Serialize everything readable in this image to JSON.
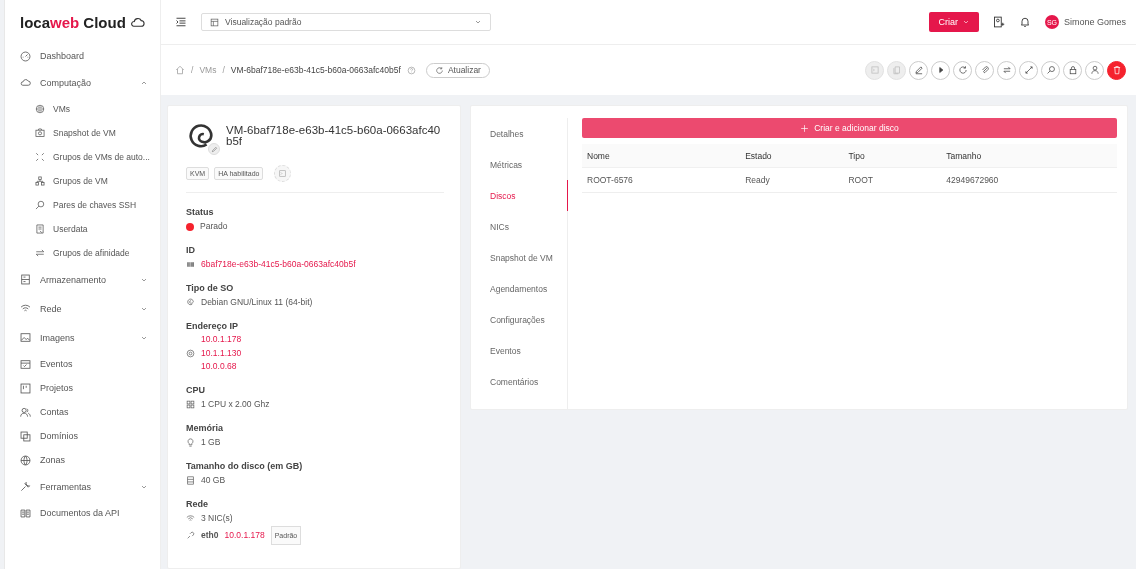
{
  "brand": {
    "prefix": "loca",
    "highlight": "web",
    "suffix": " Cloud"
  },
  "sidebar": {
    "items": [
      {
        "label": "Dashboard",
        "kind": "link"
      },
      {
        "label": "Computação",
        "kind": "group",
        "expanded": true,
        "children": [
          {
            "label": "VMs",
            "selected": false
          },
          {
            "label": "Snapshot de VM",
            "selected": false
          },
          {
            "label": "Grupos de VMs de auto...",
            "selected": false
          },
          {
            "label": "Grupos de VM",
            "selected": false
          },
          {
            "label": "Pares de chaves SSH",
            "selected": false
          },
          {
            "label": "Userdata",
            "selected": false
          },
          {
            "label": "Grupos de afinidade",
            "selected": false
          }
        ]
      },
      {
        "label": "Armazenamento",
        "kind": "group",
        "expanded": false
      },
      {
        "label": "Rede",
        "kind": "group",
        "expanded": false
      },
      {
        "label": "Imagens",
        "kind": "group",
        "expanded": false
      },
      {
        "label": "Eventos",
        "kind": "link"
      },
      {
        "label": "Projetos",
        "kind": "link"
      },
      {
        "label": "Contas",
        "kind": "link"
      },
      {
        "label": "Domínios",
        "kind": "link"
      },
      {
        "label": "Zonas",
        "kind": "link"
      },
      {
        "label": "Ferramentas",
        "kind": "group",
        "expanded": false
      },
      {
        "label": "Documentos da API",
        "kind": "link"
      }
    ]
  },
  "header": {
    "view_select": {
      "value": "Visualização padrão"
    },
    "create_button": "Criar",
    "user": {
      "initials": "SG",
      "name": "Simone Gomes"
    }
  },
  "breadcrumb": {
    "separator": "/",
    "items": [
      "VMs",
      "VM-6baf718e-e63b-41c5-b60a-0663afc40b5f"
    ],
    "refresh_button": "Atualizar"
  },
  "actions": [
    {
      "kind": "normal",
      "disabled": true
    },
    {
      "kind": "normal",
      "disabled": true
    },
    {
      "kind": "normal",
      "disabled": false
    },
    {
      "kind": "normal",
      "disabled": false
    },
    {
      "kind": "normal",
      "disabled": false
    },
    {
      "kind": "normal",
      "disabled": false
    },
    {
      "kind": "normal",
      "disabled": false
    },
    {
      "kind": "normal",
      "disabled": false
    },
    {
      "kind": "normal",
      "disabled": false
    },
    {
      "kind": "normal",
      "disabled": false
    },
    {
      "kind": "normal",
      "disabled": false
    },
    {
      "kind": "danger",
      "disabled": false
    }
  ],
  "vm_card": {
    "title": "VM-6baf718e-e63b-41c5-b60a-0663afc40b5f",
    "tags": [
      "KVM",
      "HA habilitado"
    ],
    "sections": [
      {
        "label": "Status",
        "kind": "status",
        "value": "Parado",
        "color": "#f5222d"
      },
      {
        "label": "ID",
        "kind": "link",
        "value": "6baf718e-e63b-41c5-b60a-0663afc40b5f"
      },
      {
        "label": "Tipo de SO",
        "kind": "text",
        "value": "Debian GNU/Linux 11 (64-bit)"
      },
      {
        "label": "Endereço IP",
        "kind": "list",
        "values": [
          "10.0.1.178",
          "10.1.1.130",
          "10.0.0.68"
        ]
      },
      {
        "label": "CPU",
        "kind": "text",
        "value": "1 CPU x 2.00 Ghz"
      },
      {
        "label": "Memória",
        "kind": "text",
        "value": "1 GB"
      },
      {
        "label": "Tamanho do disco (em GB)",
        "kind": "text",
        "value": "40 GB"
      },
      {
        "label": "Rede",
        "kind": "network",
        "value": "3 NIC(s)",
        "nics": [
          {
            "name": "eth0",
            "ip": "10.0.1.178",
            "tag": "Padrão"
          }
        ]
      }
    ]
  },
  "tabs": [
    {
      "label": "Detalhes",
      "selected": false
    },
    {
      "label": "Métricas",
      "selected": false
    },
    {
      "label": "Discos",
      "selected": true
    },
    {
      "label": "NICs",
      "selected": false
    },
    {
      "label": "Snapshot de VM",
      "selected": false
    },
    {
      "label": "Agendamentos",
      "selected": false
    },
    {
      "label": "Configurações",
      "selected": false
    },
    {
      "label": "Eventos",
      "selected": false
    },
    {
      "label": "Comentários",
      "selected": false
    }
  ],
  "disks": {
    "add_button": "Criar e adicionar disco",
    "columns": [
      "Nome",
      "Estado",
      "Tipo",
      "Tamanho"
    ],
    "rows": [
      [
        "ROOT-6576",
        "Ready",
        "ROOT",
        "42949672960"
      ]
    ]
  }
}
